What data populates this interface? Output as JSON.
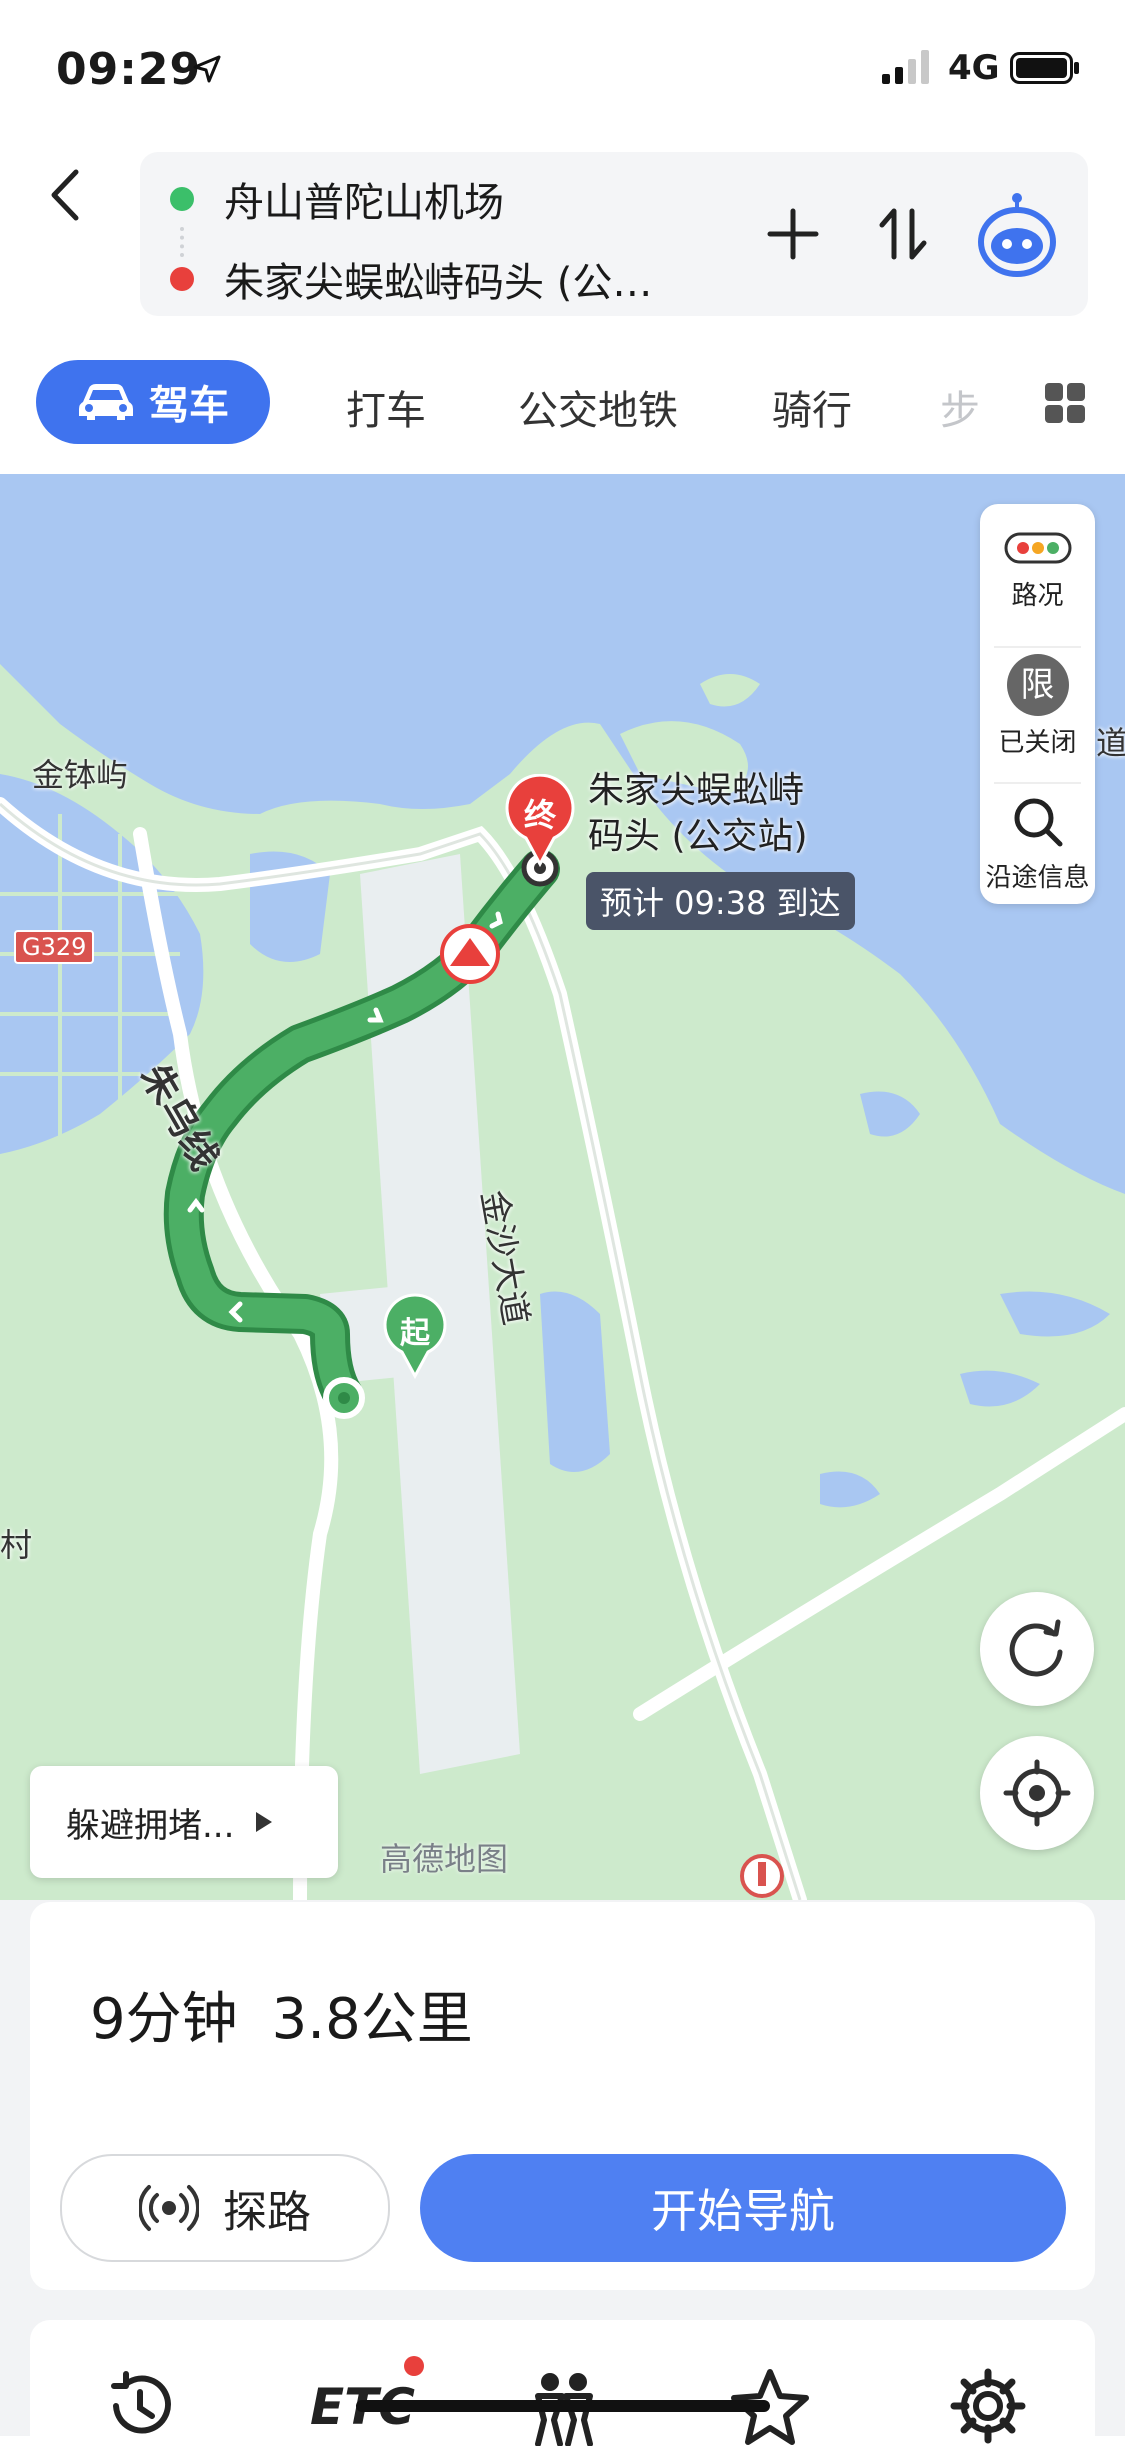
{
  "status_bar": {
    "time": "09:29",
    "network": "4G"
  },
  "route": {
    "origin": "舟山普陀山机场",
    "destination": "朱家尖蜈蚣峙码头 (公…"
  },
  "tabs": {
    "active": "驾车",
    "items": [
      "打车",
      "公交地铁",
      "骑行",
      "步"
    ]
  },
  "map": {
    "labels": {
      "island": "金钵屿",
      "road_badge": "G329",
      "route_name": "朱乌线",
      "avenue": "金沙大道",
      "cut_left": "村",
      "cut_right": "道",
      "destination_line1": "朱家尖蜈蚣峙",
      "destination_line2": "码头 (公交站)"
    },
    "eta": "预计 09:38 到达",
    "start_marker": "起",
    "end_marker": "终",
    "side_panel": {
      "traffic": "路况",
      "restriction_badge": "限",
      "restriction": "已关闭",
      "along_route": "沿途信息"
    },
    "avoid_button": "躲避拥堵...",
    "brand": "高德地图"
  },
  "summary": {
    "duration": "9分钟",
    "distance": "3.8公里"
  },
  "actions": {
    "probe": "探路",
    "navigate": "开始导航"
  },
  "toolbar": {
    "icons": [
      "history-clock-icon",
      "etc-icon",
      "companions-icon",
      "favorite-star-icon",
      "settings-gear-icon"
    ],
    "etc_label": "ETC"
  },
  "colors": {
    "accent": "#3f73ee",
    "nav_button": "#4f80f2",
    "route_green": "#4caf65",
    "water": "#a9c7f2",
    "land": "#cdeacc",
    "destination_red": "#e8403c"
  }
}
